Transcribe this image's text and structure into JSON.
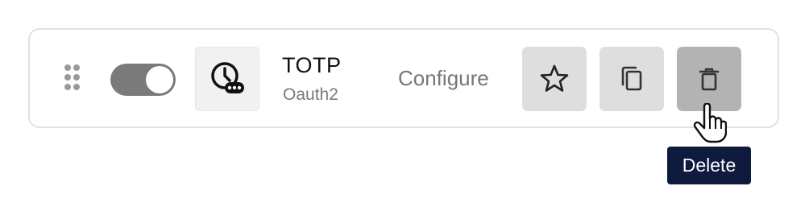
{
  "item": {
    "title": "TOTP",
    "subtitle": "Oauth2",
    "enabled": true,
    "icon": "clock-password-icon"
  },
  "actions": {
    "configure_label": "Configure",
    "star_icon": "star-icon",
    "copy_icon": "copy-icon",
    "delete_icon": "trash-icon"
  },
  "tooltip": {
    "text": "Delete"
  },
  "colors": {
    "card_border": "#e2e2e2",
    "toggle_on": "#7a7a7a",
    "button_bg": "#dedede",
    "button_hover_bg": "#b3b3b3",
    "tooltip_bg": "#0f1a3f"
  }
}
